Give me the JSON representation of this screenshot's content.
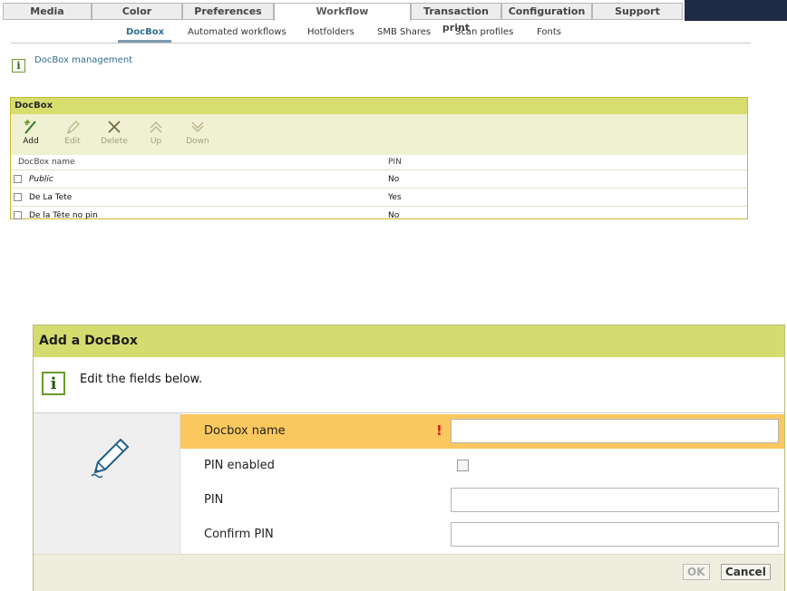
{
  "top_tabs": [
    "Media",
    "Color",
    "Preferences",
    "Workflow",
    "Transaction print",
    "Configuration",
    "Support"
  ],
  "active_top_tab": "Workflow",
  "sub_nav": [
    "DocBox",
    "Automated workflows",
    "Hotfolders",
    "SMB Shares",
    "Scan profiles",
    "Fonts"
  ],
  "active_sub_tab": "DocBox",
  "info_link": "DocBox management",
  "docbox_panel": {
    "title": "DocBox",
    "toolbar": {
      "add": "Add",
      "edit": "Edit",
      "delete": "Delete",
      "up": "Up",
      "down": "Down"
    },
    "columns": {
      "name": "DocBox name",
      "pin": "PIN"
    },
    "rows": [
      {
        "name": "Public",
        "pin": "No"
      },
      {
        "name": "De La Tete",
        "pin": "Yes"
      },
      {
        "name": "De la Tête no pin",
        "pin": "No"
      }
    ]
  },
  "dialog": {
    "title": "Add a DocBox",
    "info_text": "Edit the fields below.",
    "fields": {
      "docbox_name": "Docbox name",
      "pin_enabled": "PIN enabled",
      "pin": "PIN",
      "confirm_pin": "Confirm PIN"
    },
    "required_marker": "!",
    "ok": "OK",
    "cancel": "Cancel"
  },
  "colors": {
    "header_green": "#d7de6f",
    "toolbar_bg": "#f0f1d2",
    "highlight_row": "#fbc75f",
    "dark_block": "#1f2a44"
  }
}
